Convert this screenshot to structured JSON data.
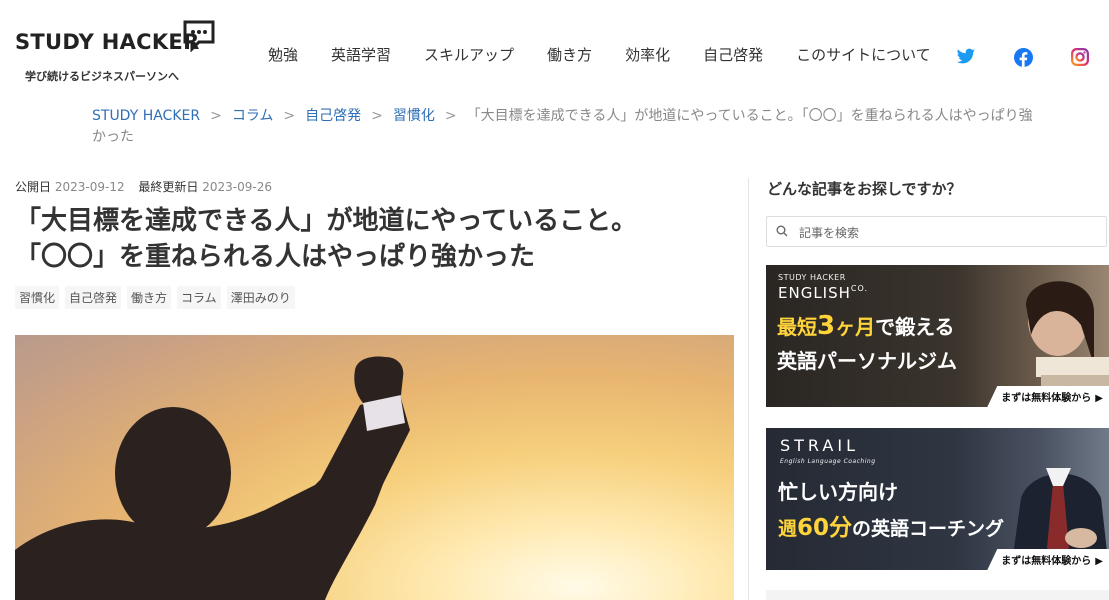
{
  "header": {
    "logo_text": "STUDY HACKER",
    "tagline": "学び続けるビジネスパーソンへ",
    "nav": [
      "勉強",
      "英語学習",
      "スキルアップ",
      "働き方",
      "効率化",
      "自己啓発",
      "このサイトについて"
    ],
    "social": [
      "twitter-icon",
      "facebook-icon",
      "instagram-icon"
    ],
    "colors": {
      "twitter": "#1d9bf0",
      "facebook": "#1877f2",
      "instagram": "#e1306c"
    }
  },
  "breadcrumb": {
    "links": [
      "STUDY HACKER",
      "コラム",
      "自己啓発",
      "習慣化"
    ],
    "separator": ">",
    "current": "「大目標を達成できる人」が地道にやっていること。「〇〇」を重ねられる人はやっぱり強かった"
  },
  "article": {
    "published_label": "公開日",
    "published_date": "2023-09-12",
    "updated_label": "最終更新日",
    "updated_date": "2023-09-26",
    "title_line1": "「大目標を達成できる人」が地道にやっていること。",
    "title_line2": "「〇〇」を重ねられる人はやっぱり強かった",
    "tags": [
      "習慣化",
      "自己啓発",
      "働き方",
      "コラム",
      "澤田みのり"
    ]
  },
  "sidebar": {
    "heading": "どんな記事をお探しですか？",
    "search_placeholder": "記事を検索",
    "banner1": {
      "small": "STUDY HACKER",
      "brand": "ENGLISH",
      "brand_sup": "CO.",
      "line1_pre": "最短",
      "line1_num": "3",
      "line1_mid": "ヶ月",
      "line1_post": "で鍛える",
      "line2": "英語パーソナルジム",
      "cta": "まずは無料体験から"
    },
    "banner2": {
      "brand": "STRAIL",
      "small": "English Language Coaching",
      "line1": "忙しい方向け",
      "line2_pre": "週",
      "line2_num": "60分",
      "line2_post": "の英語コーチング",
      "cta": "まずは無料体験から"
    }
  }
}
